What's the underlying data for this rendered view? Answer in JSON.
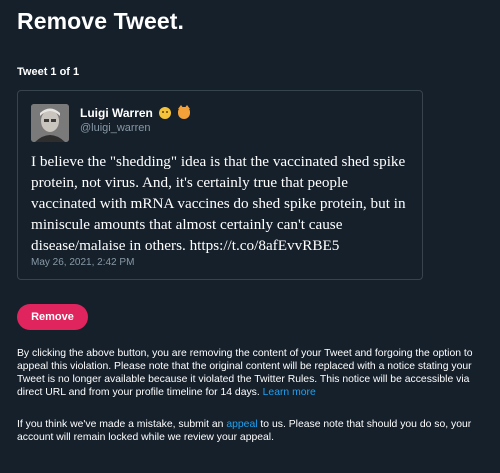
{
  "page": {
    "title": "Remove Tweet.",
    "counter": "Tweet 1 of 1"
  },
  "tweet": {
    "author_name": "Luigi Warren",
    "author_emojis": [
      "smiling-face-icon",
      "cat-face-icon"
    ],
    "author_handle": "@luigi_warren",
    "text": "I believe the \"shedding\" idea is that the vaccinated shed spike protein, not virus. And, it's certainly true that people vaccinated with mRNA vaccines do shed spike protein, but in miniscule amounts that almost certainly can't cause disease/malaise in others. https://t.co/8afEvvRBE5",
    "date": "May 26, 2021, 2:42 PM"
  },
  "actions": {
    "remove_label": "Remove"
  },
  "notice": {
    "paragraph1_text": "By clicking the above button, you are removing the content of your Tweet and forgoing the option to appeal this violation. Please note that the original content will be replaced with a notice stating your Tweet is no longer available because it violated the Twitter Rules. This notice will be accessible via direct URL and from your profile timeline for 14 days. ",
    "paragraph1_link": "Learn more",
    "paragraph2_before": "If you think we've made a mistake, submit an ",
    "paragraph2_link": "appeal",
    "paragraph2_after": " to us. Please note that should you do so, your account will remain locked while we review your appeal."
  },
  "colors": {
    "background": "#15202b",
    "accent_red": "#e0245e",
    "link_blue": "#1da1f2",
    "muted_text": "#8899a6",
    "border": "#38444d"
  }
}
